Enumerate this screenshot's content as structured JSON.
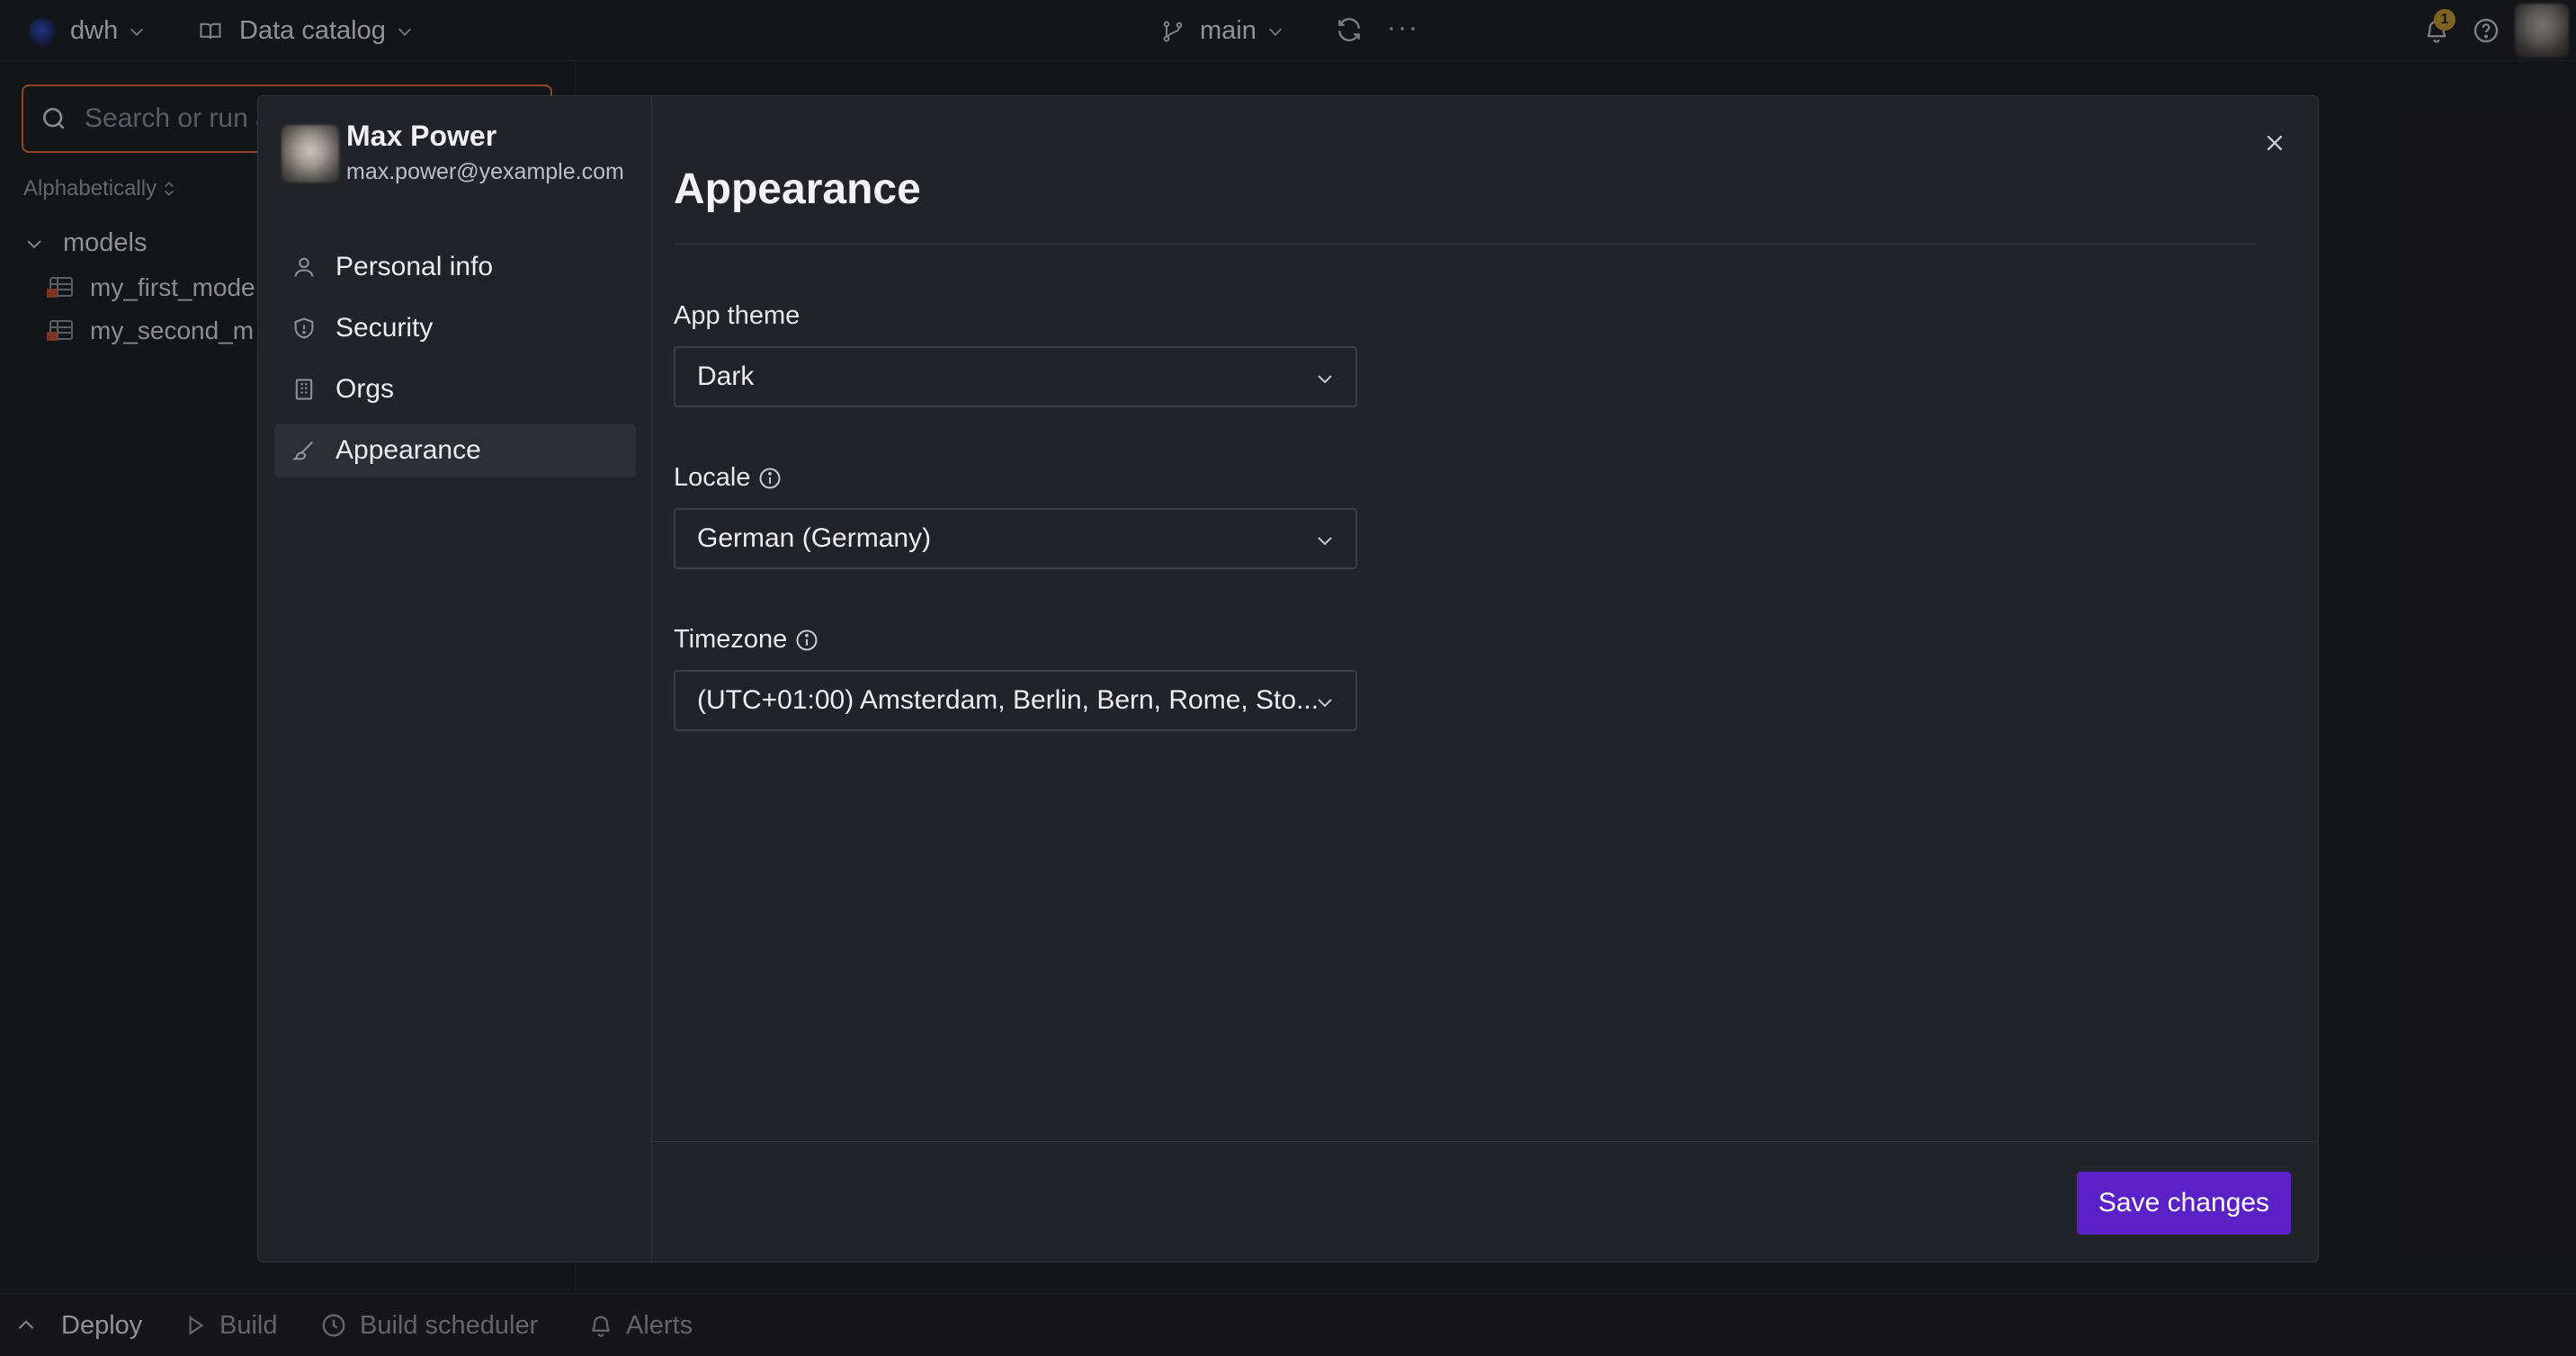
{
  "topbar": {
    "org_name": "dwh",
    "catalog_label": "Data catalog",
    "branch": "main",
    "more_label": "···",
    "notification_count": "1"
  },
  "sidebar": {
    "search_placeholder": "Search or run a",
    "sort_label": "Alphabetically",
    "folder_label": "models",
    "items": [
      {
        "label": "my_first_mode"
      },
      {
        "label": "my_second_m"
      }
    ]
  },
  "bottombar": {
    "items": [
      {
        "label": "Deploy"
      },
      {
        "label": "Build"
      },
      {
        "label": "Build scheduler"
      },
      {
        "label": "Alerts"
      }
    ]
  },
  "modal": {
    "profile": {
      "name": "Max Power",
      "email": "max.power@yexample.com"
    },
    "nav": [
      {
        "label": "Personal info",
        "icon": "user-icon"
      },
      {
        "label": "Security",
        "icon": "shield-icon"
      },
      {
        "label": "Orgs",
        "icon": "building-icon"
      },
      {
        "label": "Appearance",
        "icon": "brush-icon",
        "active": true
      }
    ],
    "title": "Appearance",
    "fields": {
      "theme": {
        "label": "App theme",
        "value": "Dark"
      },
      "locale": {
        "label": "Locale",
        "value": "German (Germany)"
      },
      "timezone": {
        "label": "Timezone",
        "value": "(UTC+01:00) Amsterdam, Berlin, Bern, Rome, Sto..."
      }
    },
    "save_label": "Save changes"
  },
  "colors": {
    "accent": "#5b21c9",
    "search_focus": "#e06a3a",
    "background": "#1b1c20",
    "modal_bg": "#222328"
  }
}
